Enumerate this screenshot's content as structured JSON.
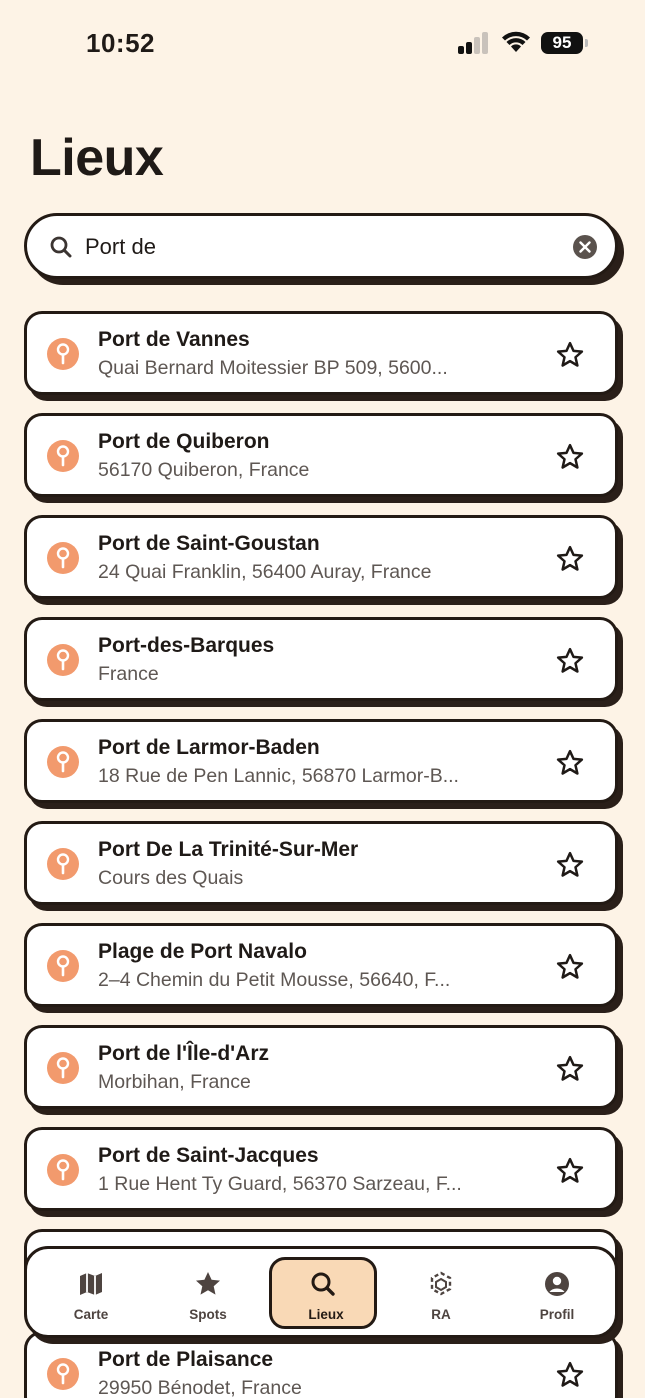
{
  "status_bar": {
    "time": "10:52",
    "battery": "95"
  },
  "header": {
    "title": "Lieux"
  },
  "search": {
    "value": "Port de",
    "placeholder": ""
  },
  "results": [
    {
      "title": "Port de Vannes",
      "subtitle": "Quai Bernard Moitessier BP 509, 5600..."
    },
    {
      "title": "Port de Quiberon",
      "subtitle": "56170 Quiberon, France"
    },
    {
      "title": "Port de Saint-Goustan",
      "subtitle": "24 Quai Franklin, 56400 Auray, France"
    },
    {
      "title": "Port-des-Barques",
      "subtitle": "France"
    },
    {
      "title": "Port de Larmor-Baden",
      "subtitle": "18 Rue de Pen Lannic, 56870 Larmor-B..."
    },
    {
      "title": "Port De La Trinité-Sur-Mer",
      "subtitle": "Cours des Quais"
    },
    {
      "title": "Plage de Port Navalo",
      "subtitle": "2–4 Chemin du Petit Mousse, 56640, F..."
    },
    {
      "title": "Port de l'Île-d'Arz",
      "subtitle": "Morbihan, France"
    },
    {
      "title": "Port de Saint-Jacques",
      "subtitle": "1 Rue Hent Ty Guard, 56370 Sarzeau, F..."
    },
    {
      "title": "",
      "subtitle": ""
    },
    {
      "title": "Port de Plaisance",
      "subtitle": "29950 Bénodet, France"
    }
  ],
  "tabs": [
    {
      "label": "Carte",
      "icon": "map-icon"
    },
    {
      "label": "Spots",
      "icon": "star-icon"
    },
    {
      "label": "Lieux",
      "icon": "search-icon",
      "active": true
    },
    {
      "label": "RA",
      "icon": "ar-icon"
    },
    {
      "label": "Profil",
      "icon": "profile-icon"
    }
  ],
  "colors": {
    "background": "#fdf3e6",
    "pin": "#f29a6d",
    "active_tab": "#f9d9b6",
    "outline": "#231a14"
  }
}
